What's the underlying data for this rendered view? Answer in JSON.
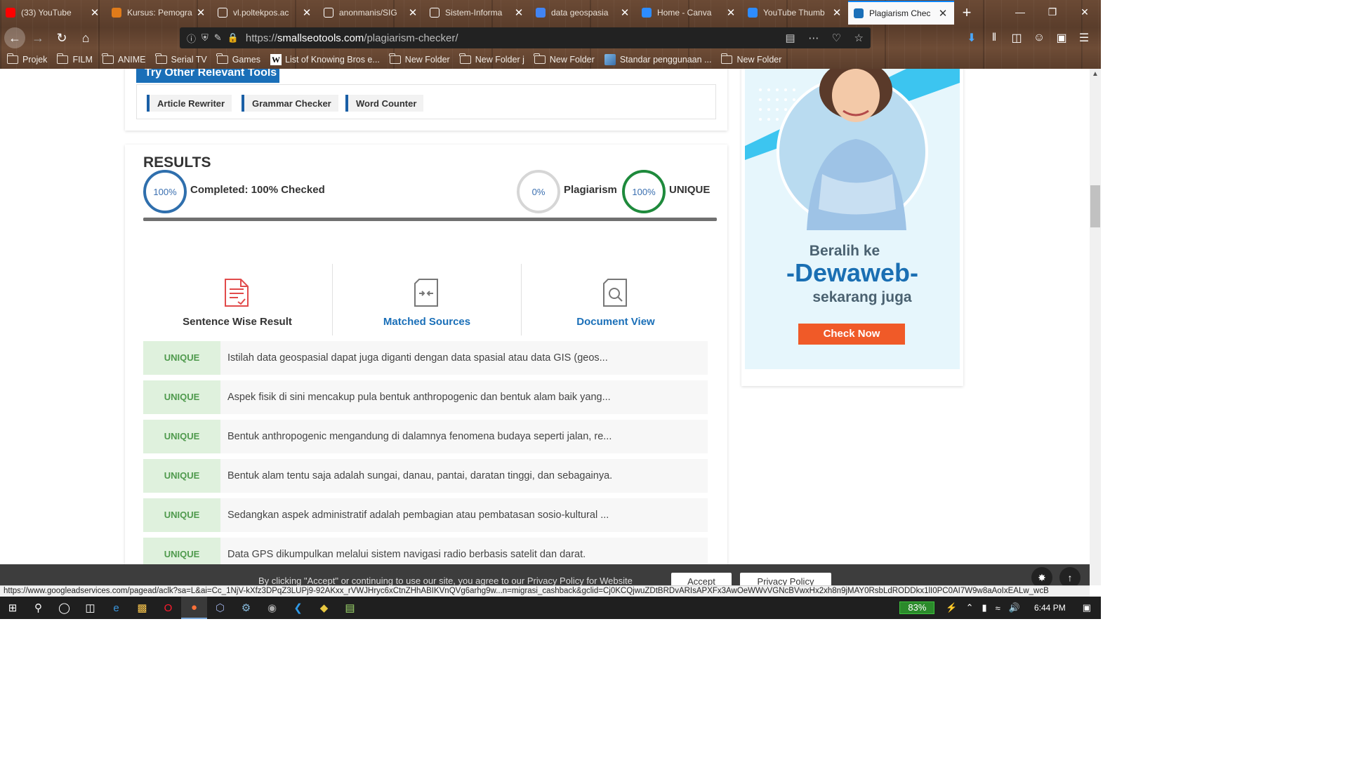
{
  "browser": {
    "tabs": [
      {
        "title": "(33) YouTube",
        "favicon": "youtube-icon",
        "color": "#ff0000"
      },
      {
        "title": "Kursus: Pemogra",
        "favicon": "chart-icon",
        "color": "#e07b1a"
      },
      {
        "title": "vl.poltekpos.ac",
        "favicon": "warning-icon",
        "color": "#ffffff"
      },
      {
        "title": "anonmanis/SIG",
        "favicon": "github-icon",
        "color": "#ffffff"
      },
      {
        "title": "Sistem-Informa",
        "favicon": "github-icon",
        "color": "#ffffff"
      },
      {
        "title": "data geospasia",
        "favicon": "google-icon",
        "color": "#4285f4"
      },
      {
        "title": "Home - Canva",
        "favicon": "canva-icon",
        "color": "#2d8cff"
      },
      {
        "title": "YouTube Thumb",
        "favicon": "canva-icon",
        "color": "#2d8cff"
      },
      {
        "title": "Plagiarism Chec",
        "favicon": "sst-icon",
        "color": "#1a6fb8"
      }
    ],
    "url_prefix": "https://",
    "url_domain": "smallseotools.com",
    "url_path": "/plagiarism-checker/",
    "bookmarks": [
      {
        "label": "Projek",
        "type": "folder"
      },
      {
        "label": "FILM",
        "type": "folder"
      },
      {
        "label": "ANIME",
        "type": "folder"
      },
      {
        "label": "Serial TV",
        "type": "folder"
      },
      {
        "label": "Games",
        "type": "folder"
      },
      {
        "label": "List of Knowing Bros e...",
        "type": "wiki"
      },
      {
        "label": "New Folder",
        "type": "folder"
      },
      {
        "label": "New Folder j",
        "type": "folder"
      },
      {
        "label": "New Folder",
        "type": "folder"
      },
      {
        "label": "Standar penggunaan ...",
        "type": "image"
      },
      {
        "label": "New Folder",
        "type": "folder"
      }
    ]
  },
  "tools": {
    "title": "Try Other Relevant Tools",
    "items": [
      "Article Rewriter",
      "Grammar Checker",
      "Word Counter"
    ]
  },
  "results": {
    "title": "RESULTS",
    "completed_pct": "100%",
    "completed_label": "Completed: 100% Checked",
    "plagiarism_pct": "0%",
    "plagiarism_label": "Plagiarism",
    "unique_pct": "100%",
    "unique_label": "UNIQUE",
    "progress_fraction": 1.0,
    "tabs": [
      {
        "label": "Sentence Wise Result",
        "color": "#333333",
        "icon": "document-check-icon"
      },
      {
        "label": "Matched Sources",
        "color": "#1a6fb8",
        "icon": "compare-arrows-icon"
      },
      {
        "label": "Document View",
        "color": "#1a6fb8",
        "icon": "document-search-icon"
      }
    ],
    "rows": [
      {
        "status": "UNIQUE",
        "text": "Istilah data geospasial dapat juga diganti dengan data spasial atau data GIS (geos..."
      },
      {
        "status": "UNIQUE",
        "text": "Aspek fisik di sini mencakup pula bentuk anthropogenic dan bentuk alam baik yang..."
      },
      {
        "status": "UNIQUE",
        "text": "Bentuk anthropogenic mengandung di dalamnya fenomena budaya seperti jalan, re..."
      },
      {
        "status": "UNIQUE",
        "text": "Bentuk alam tentu saja adalah sungai, danau, pantai, daratan tinggi, dan sebagainya."
      },
      {
        "status": "UNIQUE",
        "text": "Sedangkan aspek administratif adalah pembagian atau pembatasan sosio-kultural ..."
      },
      {
        "status": "UNIQUE",
        "text": "Data GPS dikumpulkan melalui sistem navigasi radio berbasis satelit dan darat."
      }
    ]
  },
  "ad": {
    "line1": "Beralih ke",
    "brand": "-Dewaweb-",
    "line2": "sekarang juga",
    "cta": "Check Now"
  },
  "cookie": {
    "text": "By clicking \"Accept\" or continuing to use our site, you agree to our Privacy Policy for Website",
    "accept": "Accept",
    "privacy": "Privacy Policy"
  },
  "status_url": "https://www.googleadservices.com/pagead/aclk?sa=L&ai=Cc_1NjV-kXfz3DPqZ3LUPj9-92AKxx_rVWJHryc6xCtnZHhABIKVnQVg6arhg9w...n=migrasi_cashback&gclid=Cj0KCQjwuZDtBRDvARIsAPXFx3AwOeWWvVGNcBVwxHx2xh8n9jMAY0RsbLdRODDkx1lI0PC0AI7W9w8aAoIxEALw_wcB",
  "taskbar": {
    "battery": "83%",
    "time": "6:44 PM"
  }
}
